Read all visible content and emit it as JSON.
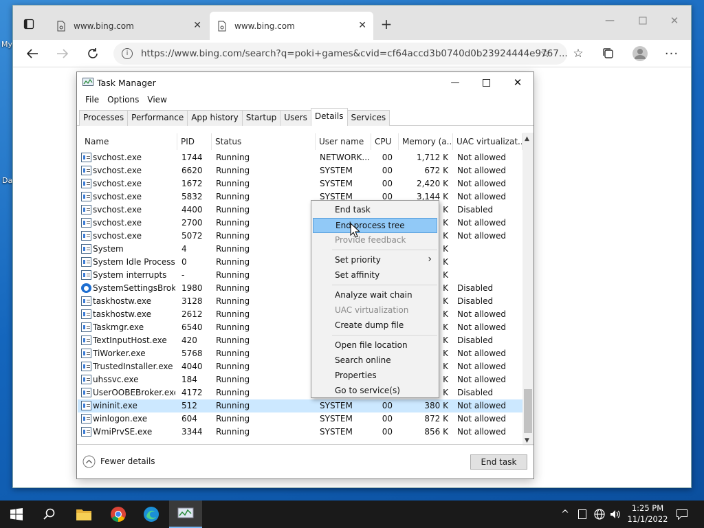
{
  "browser": {
    "tabs": [
      {
        "label": "www.bing.com"
      },
      {
        "label": "www.bing.com"
      }
    ],
    "url": "https://www.bing.com/search?q=poki+games&cvid=cf64accd3b0740d0b23924444e9767..."
  },
  "desktop": {
    "labels": [
      "My",
      "Da"
    ]
  },
  "taskmanager": {
    "title": "Task Manager",
    "menu": [
      "File",
      "Options",
      "View"
    ],
    "tabs": [
      "Processes",
      "Performance",
      "App history",
      "Startup",
      "Users",
      "Details",
      "Services"
    ],
    "selected_tab": "Details",
    "columns": [
      "Name",
      "PID",
      "Status",
      "User name",
      "CPU",
      "Memory (a...",
      "UAC virtualizat..."
    ],
    "rows": [
      [
        "svchost.exe",
        "1744",
        "Running",
        "NETWORK...",
        "00",
        "1,712 K",
        "Not allowed"
      ],
      [
        "svchost.exe",
        "6620",
        "Running",
        "SYSTEM",
        "00",
        "672 K",
        "Not allowed"
      ],
      [
        "svchost.exe",
        "1672",
        "Running",
        "SYSTEM",
        "00",
        "2,420 K",
        "Not allowed"
      ],
      [
        "svchost.exe",
        "5832",
        "Running",
        "SYSTEM",
        "00",
        "3,144 K",
        "Not allowed"
      ],
      [
        "svchost.exe",
        "4400",
        "Running",
        "",
        "",
        "K",
        "Disabled"
      ],
      [
        "svchost.exe",
        "2700",
        "Running",
        "",
        "",
        "K",
        "Not allowed"
      ],
      [
        "svchost.exe",
        "5072",
        "Running",
        "",
        "",
        "K",
        "Not allowed"
      ],
      [
        "System",
        "4",
        "Running",
        "",
        "",
        "K",
        ""
      ],
      [
        "System Idle Process",
        "0",
        "Running",
        "",
        "",
        "K",
        ""
      ],
      [
        "System interrupts",
        "-",
        "Running",
        "",
        "",
        "K",
        ""
      ],
      [
        "SystemSettingsBroke...",
        "1980",
        "Running",
        "",
        "",
        "K",
        "Disabled"
      ],
      [
        "taskhostw.exe",
        "3128",
        "Running",
        "",
        "",
        "K",
        "Disabled"
      ],
      [
        "taskhostw.exe",
        "2612",
        "Running",
        "",
        "",
        "K",
        "Not allowed"
      ],
      [
        "Taskmgr.exe",
        "6540",
        "Running",
        "",
        "",
        "K",
        "Not allowed"
      ],
      [
        "TextInputHost.exe",
        "420",
        "Running",
        "",
        "",
        "K",
        "Disabled"
      ],
      [
        "TiWorker.exe",
        "5768",
        "Running",
        "",
        "",
        "K",
        "Not allowed"
      ],
      [
        "TrustedInstaller.exe",
        "4040",
        "Running",
        "",
        "",
        "K",
        "Not allowed"
      ],
      [
        "uhssvc.exe",
        "184",
        "Running",
        "",
        "",
        "K",
        "Not allowed"
      ],
      [
        "UserOOBEBroker.exe",
        "4172",
        "Running",
        "",
        "",
        "K",
        "Disabled"
      ],
      [
        "wininit.exe",
        "512",
        "Running",
        "SYSTEM",
        "00",
        "380 K",
        "Not allowed"
      ],
      [
        "winlogon.exe",
        "604",
        "Running",
        "SYSTEM",
        "00",
        "872 K",
        "Not allowed"
      ],
      [
        "WmiPrvSE.exe",
        "3344",
        "Running",
        "SYSTEM",
        "00",
        "856 K",
        "Not allowed"
      ]
    ],
    "selected_row": 19,
    "fewer_details": "Fewer details",
    "end_task": "End task"
  },
  "context_menu": {
    "items": [
      {
        "label": "End task",
        "disabled": false
      },
      {
        "label": "End process tree",
        "disabled": false,
        "highlighted": true
      },
      {
        "label": "Provide feedback",
        "disabled": true
      },
      {
        "label": "Set priority",
        "disabled": false,
        "submenu": true
      },
      {
        "label": "Set affinity",
        "disabled": false
      },
      {
        "label": "Analyze wait chain",
        "disabled": false
      },
      {
        "label": "UAC virtualization",
        "disabled": true
      },
      {
        "label": "Create dump file",
        "disabled": false
      },
      {
        "label": "Open file location",
        "disabled": false
      },
      {
        "label": "Search online",
        "disabled": false
      },
      {
        "label": "Properties",
        "disabled": false
      },
      {
        "label": "Go to service(s)",
        "disabled": false
      }
    ]
  },
  "taskbar": {
    "time": "1:25 PM",
    "date": "11/1/2022"
  },
  "colors": {
    "selection": "#cce8ff",
    "menu_highlight": "#91c9f7",
    "taskbar": "#1a1a1a"
  }
}
